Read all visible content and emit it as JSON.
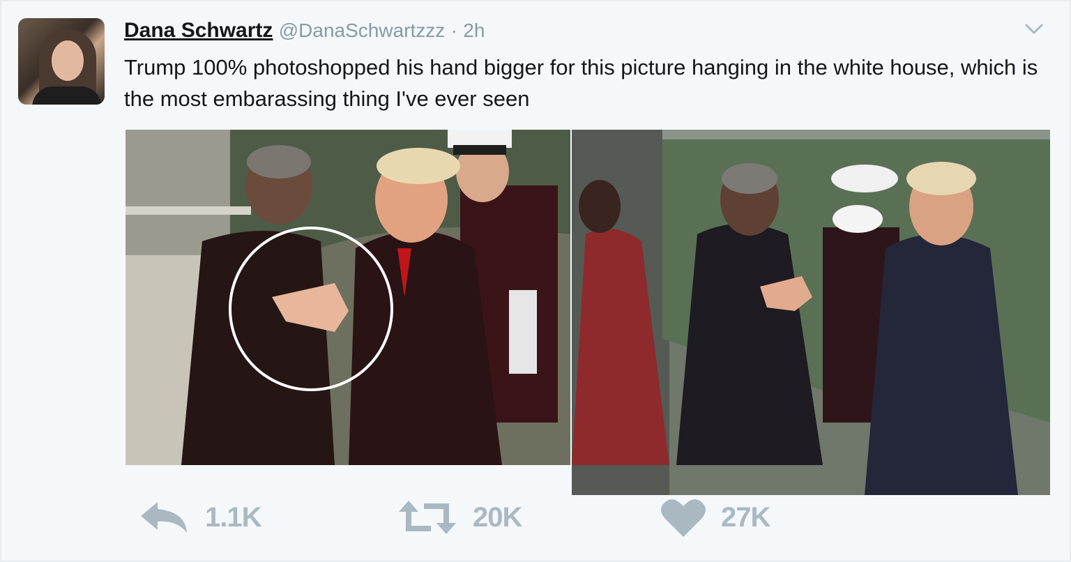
{
  "tweet": {
    "author_name": "Dana Schwartz",
    "handle": "@DanaSchwartzzz",
    "separator": "·",
    "time": "2h",
    "text": "Trump 100% photoshopped his hand bigger for this picture hanging in the white house, which is the most embarassing thing I've ever seen"
  },
  "actions": {
    "reply_count": "1.1K",
    "retweet_count": "20K",
    "like_count": "27K"
  },
  "icons": {
    "reply": "reply-icon",
    "retweet": "retweet-icon",
    "like": "heart-icon",
    "menu": "chevron-down-icon"
  },
  "colors": {
    "background": "#f5f8fa",
    "text": "#14171a",
    "muted": "#8899a6",
    "action": "#aab8c2"
  }
}
